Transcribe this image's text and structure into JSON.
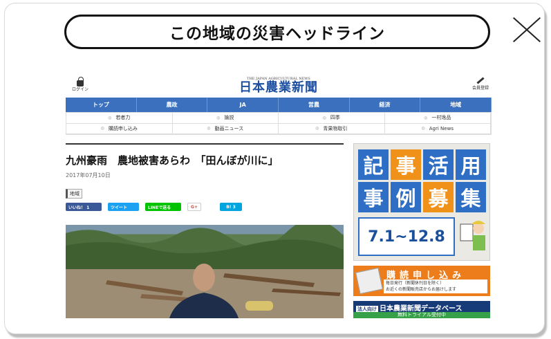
{
  "header": {
    "title": "この地域の災害ヘッドライン"
  },
  "site": {
    "login_label": "ログイン",
    "logo_sub": "THE JAPAN AGRICULTURAL NEWS",
    "logo_main": "日本農業新聞",
    "member_label": "会員登録",
    "nav": [
      "トップ",
      "農政",
      "JA",
      "営農",
      "経済",
      "地域"
    ],
    "subnav": [
      "若者力",
      "論説",
      "四季",
      "一村逸品",
      "購読申し込み",
      "動画ニュース",
      "青果物取引",
      "Agri News"
    ]
  },
  "article": {
    "title": "九州豪雨　農地被害あらわ　「田んぼが川に」",
    "date": "2017年07月10日",
    "tag": "地域",
    "share": {
      "facebook": "いいね！ 1",
      "twitter": "ツイート",
      "line": "LINEで送る",
      "gplus": "G+",
      "hatena": "B! 3"
    }
  },
  "ads": {
    "recruit": {
      "chars": [
        "記",
        "事",
        "活",
        "用",
        "事",
        "例",
        "募",
        "集"
      ],
      "dates": "7.1~12.8"
    },
    "subscribe": {
      "title": "購読申し込み",
      "line1": "毎日発行（新聞休刊日を除く）",
      "line2": "お近くの新聞販売店からお届けします"
    },
    "database": {
      "badge": "法人向け",
      "title": "日本農業新聞データベース",
      "sub": "無料トライアル受付中"
    }
  },
  "colors": {
    "nav_blue": "#3a70bd",
    "ad_orange": "#ed7c1a",
    "ad_blue": "#2e6ec4"
  }
}
